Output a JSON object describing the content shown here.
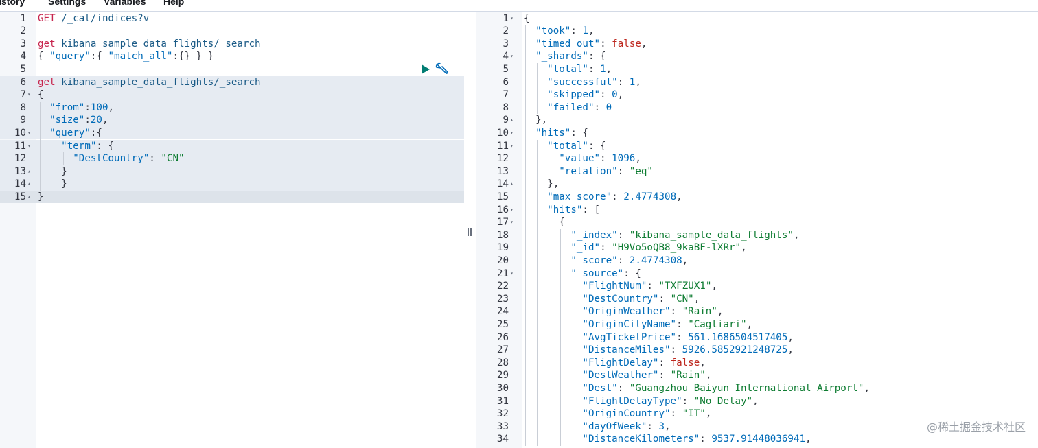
{
  "menu": {
    "items": [
      "History",
      "Settings",
      "Variables",
      "Help"
    ]
  },
  "request_editor": {
    "lines": [
      {
        "n": "1",
        "fold": "",
        "tokens": [
          [
            "method",
            "GET "
          ],
          [
            "url",
            "/_cat/indices?v"
          ]
        ]
      },
      {
        "n": "2",
        "fold": "",
        "tokens": []
      },
      {
        "n": "3",
        "fold": "",
        "tokens": [
          [
            "method",
            "get "
          ],
          [
            "url",
            "kibana_sample_data_flights/_search"
          ]
        ]
      },
      {
        "n": "4",
        "fold": "",
        "tokens": [
          [
            "punc",
            "{ "
          ],
          [
            "key",
            "\"query\""
          ],
          [
            "punc",
            ":{ "
          ],
          [
            "key",
            "\"match_all\""
          ],
          [
            "punc",
            ":{} } }"
          ]
        ]
      },
      {
        "n": "5",
        "fold": "",
        "tokens": []
      },
      {
        "n": "6",
        "fold": "",
        "tokens": [
          [
            "method",
            "get "
          ],
          [
            "url",
            "kibana_sample_data_flights/_search"
          ]
        ]
      },
      {
        "n": "7",
        "fold": "▾",
        "tokens": [
          [
            "punc",
            "{"
          ]
        ]
      },
      {
        "n": "8",
        "fold": "",
        "tokens": [
          [
            "punc",
            "  "
          ],
          [
            "key",
            "\"from\""
          ],
          [
            "punc",
            ":"
          ],
          [
            "num",
            "100"
          ],
          [
            "punc",
            ","
          ]
        ]
      },
      {
        "n": "9",
        "fold": "",
        "tokens": [
          [
            "punc",
            "  "
          ],
          [
            "key",
            "\"size\""
          ],
          [
            "punc",
            ":"
          ],
          [
            "num",
            "20"
          ],
          [
            "punc",
            ","
          ]
        ]
      },
      {
        "n": "10",
        "fold": "▾",
        "tokens": [
          [
            "punc",
            "  "
          ],
          [
            "key",
            "\"query\""
          ],
          [
            "punc",
            ":{"
          ]
        ]
      },
      {
        "n": "11",
        "fold": "▾",
        "tokens": [
          [
            "punc",
            "    "
          ],
          [
            "key",
            "\"term\""
          ],
          [
            "punc",
            ": {"
          ]
        ]
      },
      {
        "n": "12",
        "fold": "",
        "tokens": [
          [
            "punc",
            "      "
          ],
          [
            "key",
            "\"DestCountry\""
          ],
          [
            "punc",
            ": "
          ],
          [
            "str",
            "\"CN\""
          ]
        ]
      },
      {
        "n": "13",
        "fold": "▴",
        "tokens": [
          [
            "punc",
            "    }"
          ]
        ]
      },
      {
        "n": "14",
        "fold": "▴",
        "tokens": [
          [
            "punc",
            "    }"
          ]
        ]
      },
      {
        "n": "15",
        "fold": "▴",
        "tokens": [
          [
            "punc",
            "}"
          ]
        ]
      }
    ]
  },
  "response_viewer": {
    "lines": [
      {
        "n": "1",
        "fold": "▾",
        "tokens": [
          [
            "punc",
            "{"
          ]
        ]
      },
      {
        "n": "2",
        "fold": "",
        "tokens": [
          [
            "punc",
            "  "
          ],
          [
            "key",
            "\"took\""
          ],
          [
            "punc",
            ": "
          ],
          [
            "num",
            "1"
          ],
          [
            "punc",
            ","
          ]
        ]
      },
      {
        "n": "3",
        "fold": "",
        "tokens": [
          [
            "punc",
            "  "
          ],
          [
            "key",
            "\"timed_out\""
          ],
          [
            "punc",
            ": "
          ],
          [
            "bool",
            "false"
          ],
          [
            "punc",
            ","
          ]
        ]
      },
      {
        "n": "4",
        "fold": "▾",
        "tokens": [
          [
            "punc",
            "  "
          ],
          [
            "key",
            "\"_shards\""
          ],
          [
            "punc",
            ": {"
          ]
        ]
      },
      {
        "n": "5",
        "fold": "",
        "tokens": [
          [
            "punc",
            "    "
          ],
          [
            "key",
            "\"total\""
          ],
          [
            "punc",
            ": "
          ],
          [
            "num",
            "1"
          ],
          [
            "punc",
            ","
          ]
        ]
      },
      {
        "n": "6",
        "fold": "",
        "tokens": [
          [
            "punc",
            "    "
          ],
          [
            "key",
            "\"successful\""
          ],
          [
            "punc",
            ": "
          ],
          [
            "num",
            "1"
          ],
          [
            "punc",
            ","
          ]
        ]
      },
      {
        "n": "7",
        "fold": "",
        "tokens": [
          [
            "punc",
            "    "
          ],
          [
            "key",
            "\"skipped\""
          ],
          [
            "punc",
            ": "
          ],
          [
            "num",
            "0"
          ],
          [
            "punc",
            ","
          ]
        ]
      },
      {
        "n": "8",
        "fold": "",
        "tokens": [
          [
            "punc",
            "    "
          ],
          [
            "key",
            "\"failed\""
          ],
          [
            "punc",
            ": "
          ],
          [
            "num",
            "0"
          ]
        ]
      },
      {
        "n": "9",
        "fold": "▴",
        "tokens": [
          [
            "punc",
            "  },"
          ]
        ]
      },
      {
        "n": "10",
        "fold": "▾",
        "tokens": [
          [
            "punc",
            "  "
          ],
          [
            "key",
            "\"hits\""
          ],
          [
            "punc",
            ": {"
          ]
        ]
      },
      {
        "n": "11",
        "fold": "▾",
        "tokens": [
          [
            "punc",
            "    "
          ],
          [
            "key",
            "\"total\""
          ],
          [
            "punc",
            ": {"
          ]
        ]
      },
      {
        "n": "12",
        "fold": "",
        "tokens": [
          [
            "punc",
            "      "
          ],
          [
            "key",
            "\"value\""
          ],
          [
            "punc",
            ": "
          ],
          [
            "num",
            "1096"
          ],
          [
            "punc",
            ","
          ]
        ]
      },
      {
        "n": "13",
        "fold": "",
        "tokens": [
          [
            "punc",
            "      "
          ],
          [
            "key",
            "\"relation\""
          ],
          [
            "punc",
            ": "
          ],
          [
            "str",
            "\"eq\""
          ]
        ]
      },
      {
        "n": "14",
        "fold": "▴",
        "tokens": [
          [
            "punc",
            "    },"
          ]
        ]
      },
      {
        "n": "15",
        "fold": "",
        "tokens": [
          [
            "punc",
            "    "
          ],
          [
            "key",
            "\"max_score\""
          ],
          [
            "punc",
            ": "
          ],
          [
            "num",
            "2.4774308"
          ],
          [
            "punc",
            ","
          ]
        ]
      },
      {
        "n": "16",
        "fold": "▾",
        "tokens": [
          [
            "punc",
            "    "
          ],
          [
            "key",
            "\"hits\""
          ],
          [
            "punc",
            ": ["
          ]
        ]
      },
      {
        "n": "17",
        "fold": "▾",
        "tokens": [
          [
            "punc",
            "      {"
          ]
        ]
      },
      {
        "n": "18",
        "fold": "",
        "tokens": [
          [
            "punc",
            "        "
          ],
          [
            "key",
            "\"_index\""
          ],
          [
            "punc",
            ": "
          ],
          [
            "str",
            "\"kibana_sample_data_flights\""
          ],
          [
            "punc",
            ","
          ]
        ]
      },
      {
        "n": "19",
        "fold": "",
        "tokens": [
          [
            "punc",
            "        "
          ],
          [
            "key",
            "\"_id\""
          ],
          [
            "punc",
            ": "
          ],
          [
            "str",
            "\"H9Vo5oQB8_9kaBF-lXRr\""
          ],
          [
            "punc",
            ","
          ]
        ]
      },
      {
        "n": "20",
        "fold": "",
        "tokens": [
          [
            "punc",
            "        "
          ],
          [
            "key",
            "\"_score\""
          ],
          [
            "punc",
            ": "
          ],
          [
            "num",
            "2.4774308"
          ],
          [
            "punc",
            ","
          ]
        ]
      },
      {
        "n": "21",
        "fold": "▾",
        "tokens": [
          [
            "punc",
            "        "
          ],
          [
            "key",
            "\"_source\""
          ],
          [
            "punc",
            ": {"
          ]
        ]
      },
      {
        "n": "22",
        "fold": "",
        "tokens": [
          [
            "punc",
            "          "
          ],
          [
            "key",
            "\"FlightNum\""
          ],
          [
            "punc",
            ": "
          ],
          [
            "str",
            "\"TXFZUX1\""
          ],
          [
            "punc",
            ","
          ]
        ]
      },
      {
        "n": "23",
        "fold": "",
        "tokens": [
          [
            "punc",
            "          "
          ],
          [
            "key",
            "\"DestCountry\""
          ],
          [
            "punc",
            ": "
          ],
          [
            "str",
            "\"CN\""
          ],
          [
            "punc",
            ","
          ]
        ]
      },
      {
        "n": "24",
        "fold": "",
        "tokens": [
          [
            "punc",
            "          "
          ],
          [
            "key",
            "\"OriginWeather\""
          ],
          [
            "punc",
            ": "
          ],
          [
            "str",
            "\"Rain\""
          ],
          [
            "punc",
            ","
          ]
        ]
      },
      {
        "n": "25",
        "fold": "",
        "tokens": [
          [
            "punc",
            "          "
          ],
          [
            "key",
            "\"OriginCityName\""
          ],
          [
            "punc",
            ": "
          ],
          [
            "str",
            "\"Cagliari\""
          ],
          [
            "punc",
            ","
          ]
        ]
      },
      {
        "n": "26",
        "fold": "",
        "tokens": [
          [
            "punc",
            "          "
          ],
          [
            "key",
            "\"AvgTicketPrice\""
          ],
          [
            "punc",
            ": "
          ],
          [
            "num",
            "561.1686504517405"
          ],
          [
            "punc",
            ","
          ]
        ]
      },
      {
        "n": "27",
        "fold": "",
        "tokens": [
          [
            "punc",
            "          "
          ],
          [
            "key",
            "\"DistanceMiles\""
          ],
          [
            "punc",
            ": "
          ],
          [
            "num",
            "5926.5852921248725"
          ],
          [
            "punc",
            ","
          ]
        ]
      },
      {
        "n": "28",
        "fold": "",
        "tokens": [
          [
            "punc",
            "          "
          ],
          [
            "key",
            "\"FlightDelay\""
          ],
          [
            "punc",
            ": "
          ],
          [
            "bool",
            "false"
          ],
          [
            "punc",
            ","
          ]
        ]
      },
      {
        "n": "29",
        "fold": "",
        "tokens": [
          [
            "punc",
            "          "
          ],
          [
            "key",
            "\"DestWeather\""
          ],
          [
            "punc",
            ": "
          ],
          [
            "str",
            "\"Rain\""
          ],
          [
            "punc",
            ","
          ]
        ]
      },
      {
        "n": "30",
        "fold": "",
        "tokens": [
          [
            "punc",
            "          "
          ],
          [
            "key",
            "\"Dest\""
          ],
          [
            "punc",
            ": "
          ],
          [
            "str",
            "\"Guangzhou Baiyun International Airport\""
          ],
          [
            "punc",
            ","
          ]
        ]
      },
      {
        "n": "31",
        "fold": "",
        "tokens": [
          [
            "punc",
            "          "
          ],
          [
            "key",
            "\"FlightDelayType\""
          ],
          [
            "punc",
            ": "
          ],
          [
            "str",
            "\"No Delay\""
          ],
          [
            "punc",
            ","
          ]
        ]
      },
      {
        "n": "32",
        "fold": "",
        "tokens": [
          [
            "punc",
            "          "
          ],
          [
            "key",
            "\"OriginCountry\""
          ],
          [
            "punc",
            ": "
          ],
          [
            "str",
            "\"IT\""
          ],
          [
            "punc",
            ","
          ]
        ]
      },
      {
        "n": "33",
        "fold": "",
        "tokens": [
          [
            "punc",
            "          "
          ],
          [
            "key",
            "\"dayOfWeek\""
          ],
          [
            "punc",
            ": "
          ],
          [
            "num",
            "3"
          ],
          [
            "punc",
            ","
          ]
        ]
      },
      {
        "n": "34",
        "fold": "",
        "tokens": [
          [
            "punc",
            "          "
          ],
          [
            "key",
            "\"DistanceKilometers\""
          ],
          [
            "punc",
            ": "
          ],
          [
            "num",
            "9537.91448036941"
          ],
          [
            "punc",
            ","
          ]
        ]
      }
    ]
  },
  "watermark": "@稀土掘金技术社区",
  "colors": {
    "method": "#c7254e",
    "key": "#006bb8",
    "string": "#0e7c32",
    "number": "#006bb8",
    "boolean": "#bd271e",
    "run_button": "#017d73"
  },
  "icons": {
    "run": "play-icon",
    "settings": "wrench-icon",
    "resizer": "grip-icon"
  }
}
